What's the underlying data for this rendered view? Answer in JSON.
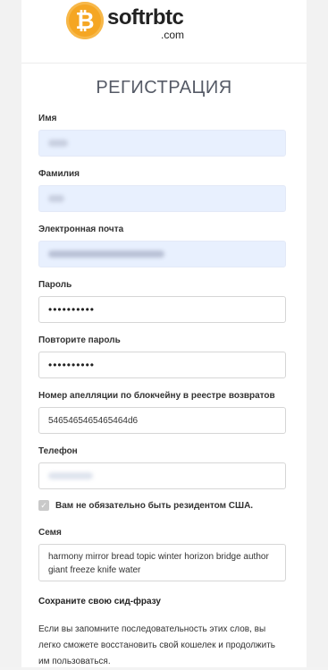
{
  "brand": {
    "coin_symbol": "₿",
    "name": "softrbtc",
    "domain": ".com",
    "coin_color": "#f5a623"
  },
  "form": {
    "title": "РЕГИСТРАЦИЯ",
    "first_name": {
      "label": "Имя",
      "value": ""
    },
    "last_name": {
      "label": "Фамилия",
      "value": ""
    },
    "email": {
      "label": "Электронная почта",
      "value": ""
    },
    "password": {
      "label": "Пароль",
      "value": "••••••••••"
    },
    "password_repeat": {
      "label": "Повторите пароль",
      "value": "••••••••••"
    },
    "appeal_number": {
      "label": "Номер апелляции по блокчейну в реестре возвратов",
      "value": "5465465465465464d6"
    },
    "phone": {
      "label": "Телефон",
      "value": ""
    },
    "us_resident_checkbox": {
      "label": "Вам не обязательно быть резидентом США.",
      "checked": true,
      "check_glyph": "✓"
    },
    "seed": {
      "label": "Семя",
      "value": "harmony mirror bread topic winter horizon bridge author giant freeze knife water"
    },
    "save_title": "Сохраните свою сид-фразу",
    "save_text": "Если вы запомните последовательность этих слов, вы легко сможете восстановить свой кошелек и продолжить им пользоваться."
  }
}
